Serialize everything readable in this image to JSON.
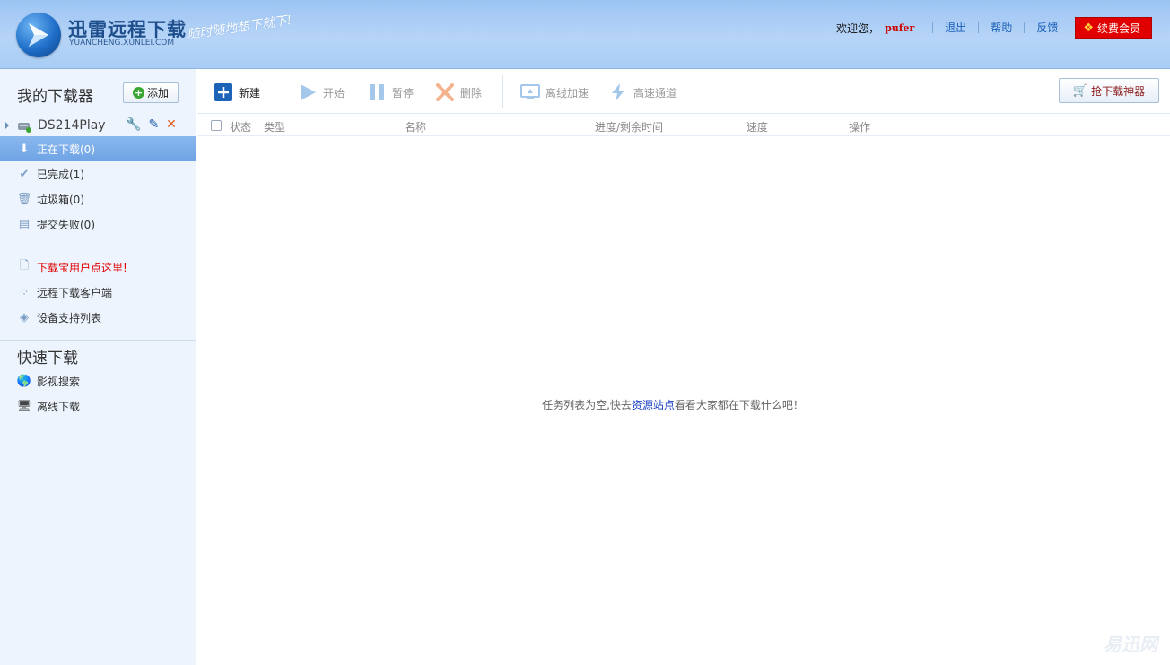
{
  "header": {
    "logo_title": "迅雷远程下载",
    "logo_sub": "YUANCHENG.XUNLEI.COM",
    "slogan": "随时随地想下就下!",
    "welcome": "欢迎您，",
    "username": "pufer",
    "links": [
      "退出",
      "帮助",
      "反馈"
    ],
    "vip_label": "续费会员"
  },
  "sidebar": {
    "title": "我的下载器",
    "add_label": "添加",
    "device_name": "DS214Play",
    "nav": [
      {
        "label": "正在下载(0)",
        "active": true
      },
      {
        "label": "已完成(1)"
      },
      {
        "label": "垃圾箱(0)"
      },
      {
        "label": "提交失败(0)"
      }
    ],
    "extra_links": [
      {
        "label": "下载宝用户点这里!"
      },
      {
        "label": "远程下载客户端"
      },
      {
        "label": "设备支持列表"
      }
    ],
    "quick_title": "快速下载",
    "quick_links": [
      {
        "label": "影视搜索"
      },
      {
        "label": "离线下载"
      }
    ]
  },
  "toolbar": {
    "new_label": "新建",
    "start_label": "开始",
    "pause_label": "暂停",
    "delete_label": "删除",
    "offline_label": "离线加速",
    "highspeed_label": "高速通道",
    "grab_label": "抢下载神器"
  },
  "table": {
    "columns": [
      "状态",
      "类型",
      "名称",
      "进度/剩余时间",
      "速度",
      "操作"
    ]
  },
  "empty": {
    "prefix": "任务列表为空,快去",
    "link": "资源站点",
    "suffix": "看看大家都在下载什么吧！"
  },
  "watermark": "易迅网",
  "colors": {
    "header_bg": "#a9cdf5",
    "accent": "#1b5fb8",
    "vip_red": "#e00000",
    "sidebar_bg": "#edf4fd",
    "active_item": "#7aaceb"
  }
}
